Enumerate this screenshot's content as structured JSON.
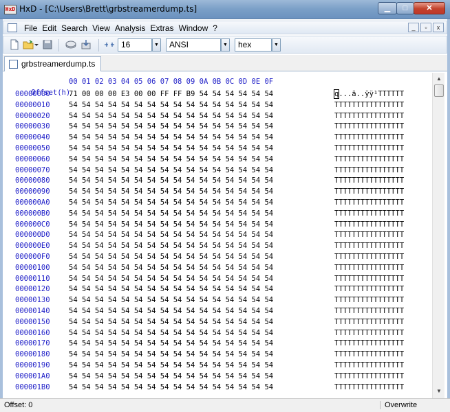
{
  "window": {
    "app_icon_text": "HxD",
    "title": "HxD - [C:\\Users\\Brett\\grbstreamerdump.ts]",
    "minimize_glyph": "▁",
    "maximize_glyph": "□",
    "close_glyph": "✕"
  },
  "menu": {
    "items": [
      "File",
      "Edit",
      "Search",
      "View",
      "Analysis",
      "Extras",
      "Window",
      "?"
    ],
    "mdi_minimize": "_",
    "mdi_restore": "▫",
    "mdi_close": "x"
  },
  "toolbar": {
    "bytes_per_row": "16",
    "charset": "ANSI",
    "offset_base": "hex",
    "icons": [
      "new-file-icon",
      "open-folder-icon",
      "save-icon",
      "disk-icon",
      "export-icon",
      "columns-icon"
    ]
  },
  "tab": {
    "label": "grbstreamerdump.ts"
  },
  "hex": {
    "header_offset": "Offset(h)",
    "header_columns": "00 01 02 03 04 05 06 07 08 09 0A 0B 0C 0D 0E 0F",
    "rows": [
      {
        "offset": "00000000",
        "hex": "71 00 00 00 E3 00 00 FF FF B9 54 54 54 54 54 54",
        "text_first": "q",
        "text_rest": "...ã..ÿÿ¹TTTTTT"
      },
      {
        "offset": "00000010",
        "hex": "54 54 54 54 54 54 54 54 54 54 54 54 54 54 54 54",
        "text_first": "",
        "text_rest": "TTTTTTTTTTTTTTTT"
      },
      {
        "offset": "00000020",
        "hex": "54 54 54 54 54 54 54 54 54 54 54 54 54 54 54 54",
        "text_first": "",
        "text_rest": "TTTTTTTTTTTTTTTT"
      },
      {
        "offset": "00000030",
        "hex": "54 54 54 54 54 54 54 54 54 54 54 54 54 54 54 54",
        "text_first": "",
        "text_rest": "TTTTTTTTTTTTTTTT"
      },
      {
        "offset": "00000040",
        "hex": "54 54 54 54 54 54 54 54 54 54 54 54 54 54 54 54",
        "text_first": "",
        "text_rest": "TTTTTTTTTTTTTTTT"
      },
      {
        "offset": "00000050",
        "hex": "54 54 54 54 54 54 54 54 54 54 54 54 54 54 54 54",
        "text_first": "",
        "text_rest": "TTTTTTTTTTTTTTTT"
      },
      {
        "offset": "00000060",
        "hex": "54 54 54 54 54 54 54 54 54 54 54 54 54 54 54 54",
        "text_first": "",
        "text_rest": "TTTTTTTTTTTTTTTT"
      },
      {
        "offset": "00000070",
        "hex": "54 54 54 54 54 54 54 54 54 54 54 54 54 54 54 54",
        "text_first": "",
        "text_rest": "TTTTTTTTTTTTTTTT"
      },
      {
        "offset": "00000080",
        "hex": "54 54 54 54 54 54 54 54 54 54 54 54 54 54 54 54",
        "text_first": "",
        "text_rest": "TTTTTTTTTTTTTTTT"
      },
      {
        "offset": "00000090",
        "hex": "54 54 54 54 54 54 54 54 54 54 54 54 54 54 54 54",
        "text_first": "",
        "text_rest": "TTTTTTTTTTTTTTTT"
      },
      {
        "offset": "000000A0",
        "hex": "54 54 54 54 54 54 54 54 54 54 54 54 54 54 54 54",
        "text_first": "",
        "text_rest": "TTTTTTTTTTTTTTTT"
      },
      {
        "offset": "000000B0",
        "hex": "54 54 54 54 54 54 54 54 54 54 54 54 54 54 54 54",
        "text_first": "",
        "text_rest": "TTTTTTTTTTTTTTTT"
      },
      {
        "offset": "000000C0",
        "hex": "54 54 54 54 54 54 54 54 54 54 54 54 54 54 54 54",
        "text_first": "",
        "text_rest": "TTTTTTTTTTTTTTTT"
      },
      {
        "offset": "000000D0",
        "hex": "54 54 54 54 54 54 54 54 54 54 54 54 54 54 54 54",
        "text_first": "",
        "text_rest": "TTTTTTTTTTTTTTTT"
      },
      {
        "offset": "000000E0",
        "hex": "54 54 54 54 54 54 54 54 54 54 54 54 54 54 54 54",
        "text_first": "",
        "text_rest": "TTTTTTTTTTTTTTTT"
      },
      {
        "offset": "000000F0",
        "hex": "54 54 54 54 54 54 54 54 54 54 54 54 54 54 54 54",
        "text_first": "",
        "text_rest": "TTTTTTTTTTTTTTTT"
      },
      {
        "offset": "00000100",
        "hex": "54 54 54 54 54 54 54 54 54 54 54 54 54 54 54 54",
        "text_first": "",
        "text_rest": "TTTTTTTTTTTTTTTT"
      },
      {
        "offset": "00000110",
        "hex": "54 54 54 54 54 54 54 54 54 54 54 54 54 54 54 54",
        "text_first": "",
        "text_rest": "TTTTTTTTTTTTTTTT"
      },
      {
        "offset": "00000120",
        "hex": "54 54 54 54 54 54 54 54 54 54 54 54 54 54 54 54",
        "text_first": "",
        "text_rest": "TTTTTTTTTTTTTTTT"
      },
      {
        "offset": "00000130",
        "hex": "54 54 54 54 54 54 54 54 54 54 54 54 54 54 54 54",
        "text_first": "",
        "text_rest": "TTTTTTTTTTTTTTTT"
      },
      {
        "offset": "00000140",
        "hex": "54 54 54 54 54 54 54 54 54 54 54 54 54 54 54 54",
        "text_first": "",
        "text_rest": "TTTTTTTTTTTTTTTT"
      },
      {
        "offset": "00000150",
        "hex": "54 54 54 54 54 54 54 54 54 54 54 54 54 54 54 54",
        "text_first": "",
        "text_rest": "TTTTTTTTTTTTTTTT"
      },
      {
        "offset": "00000160",
        "hex": "54 54 54 54 54 54 54 54 54 54 54 54 54 54 54 54",
        "text_first": "",
        "text_rest": "TTTTTTTTTTTTTTTT"
      },
      {
        "offset": "00000170",
        "hex": "54 54 54 54 54 54 54 54 54 54 54 54 54 54 54 54",
        "text_first": "",
        "text_rest": "TTTTTTTTTTTTTTTT"
      },
      {
        "offset": "00000180",
        "hex": "54 54 54 54 54 54 54 54 54 54 54 54 54 54 54 54",
        "text_first": "",
        "text_rest": "TTTTTTTTTTTTTTTT"
      },
      {
        "offset": "00000190",
        "hex": "54 54 54 54 54 54 54 54 54 54 54 54 54 54 54 54",
        "text_first": "",
        "text_rest": "TTTTTTTTTTTTTTTT"
      },
      {
        "offset": "000001A0",
        "hex": "54 54 54 54 54 54 54 54 54 54 54 54 54 54 54 54",
        "text_first": "",
        "text_rest": "TTTTTTTTTTTTTTTT"
      },
      {
        "offset": "000001B0",
        "hex": "54 54 54 54 54 54 54 54 54 54 54 54 54 54 54 54",
        "text_first": "",
        "text_rest": "TTTTTTTTTTTTTTTT"
      }
    ]
  },
  "scrollbar": {
    "up_glyph": "▲",
    "down_glyph": "▼"
  },
  "status": {
    "left": "Offset: 0",
    "right": "Overwrite"
  }
}
